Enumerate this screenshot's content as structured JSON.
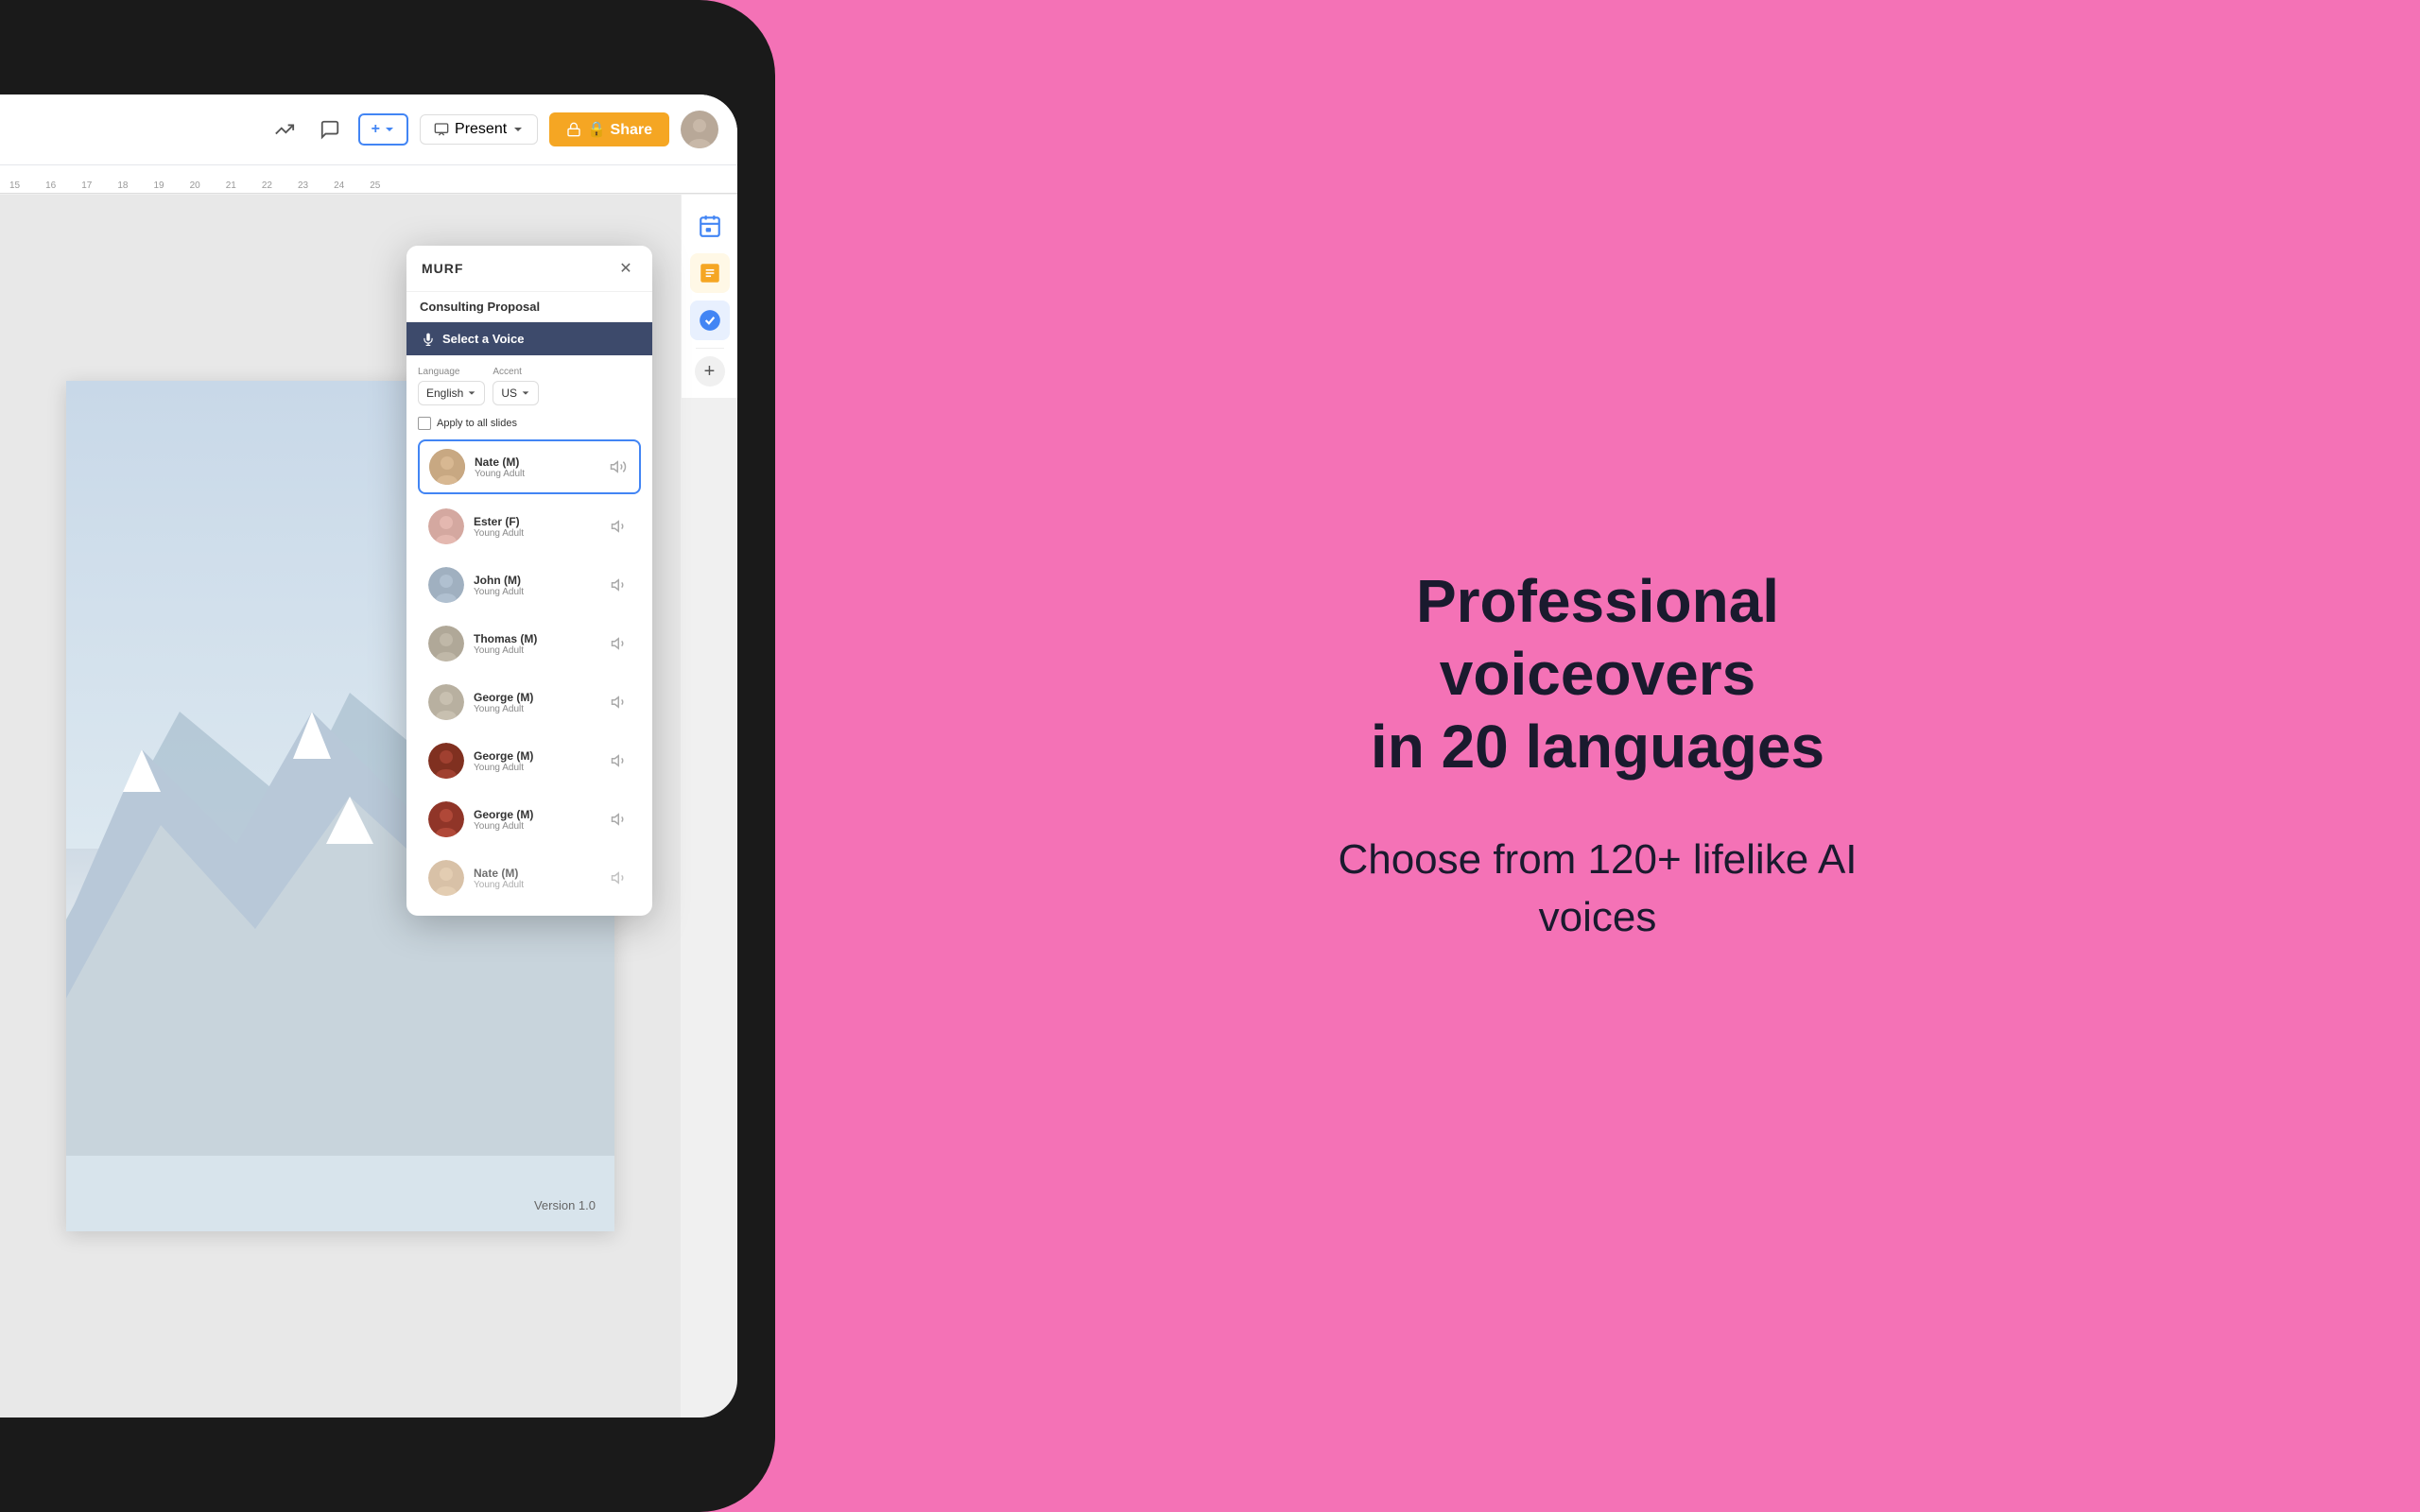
{
  "background_color": "#f472b6",
  "laptop": {
    "toolbar": {
      "trend_icon": "📈",
      "comment_icon": "💬",
      "add_button": "+ ▾",
      "present_button": "Present",
      "share_button": "🔒 Share",
      "present_icon": "▶"
    },
    "ruler": {
      "numbers": [
        "15",
        "16",
        "17",
        "18",
        "19",
        "20",
        "21",
        "22",
        "23",
        "24",
        "25"
      ]
    },
    "slide": {
      "version_text": "Version 1.0"
    },
    "sidebar_icons": [
      {
        "name": "calendar",
        "icon": "📅"
      },
      {
        "name": "sticky",
        "icon": "🟨"
      },
      {
        "name": "check",
        "icon": "✅"
      }
    ]
  },
  "murf_dialog": {
    "title": "MURF",
    "close_icon": "✕",
    "proposal_title": "Consulting Proposal",
    "select_voice_label": "Select a Voice",
    "mic_icon": "🎤",
    "language_label": "Language",
    "language_value": "English",
    "accent_label": "Accent",
    "accent_value": "US",
    "apply_label": "Apply to all slides",
    "voices": [
      {
        "name": "Nate (M)",
        "type": "Young Adult",
        "selected": true,
        "avatar_class": "avatar-nate"
      },
      {
        "name": "Ester (F)",
        "type": "Young Adult",
        "selected": false,
        "avatar_class": "avatar-ester"
      },
      {
        "name": "John (M)",
        "type": "Young Adult",
        "selected": false,
        "avatar_class": "avatar-john"
      },
      {
        "name": "Thomas (M)",
        "type": "Young Adult",
        "selected": false,
        "avatar_class": "avatar-thomas"
      },
      {
        "name": "George (M)",
        "type": "Young Adult",
        "selected": false,
        "avatar_class": "avatar-george1"
      },
      {
        "name": "George (M)",
        "type": "Young Adult",
        "selected": false,
        "avatar_class": "avatar-george2"
      },
      {
        "name": "George (M)",
        "type": "Young Adult",
        "selected": false,
        "avatar_class": "avatar-george3"
      },
      {
        "name": "Nate (M)",
        "type": "Young Adult",
        "selected": false,
        "avatar_class": "avatar-nate"
      }
    ]
  },
  "hero": {
    "title": "Professional voiceovers\nin 20 languages",
    "subtitle": "Choose from 120+ lifelike AI\nvoices"
  }
}
